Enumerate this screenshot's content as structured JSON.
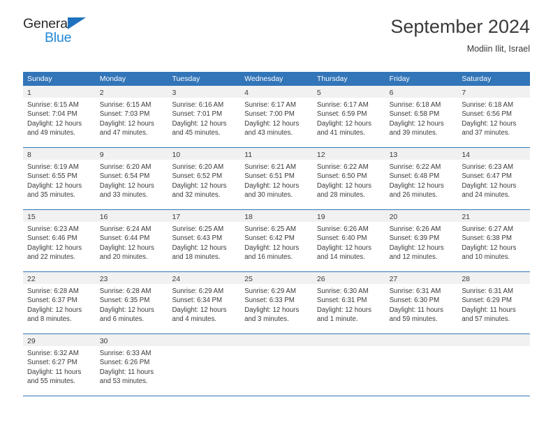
{
  "brand": {
    "name_top": "General",
    "name_bottom": "Blue",
    "triangle_color": "#1f72bd",
    "text_color_bottom": "#1f86d8"
  },
  "header": {
    "title": "September 2024",
    "subtitle": "Modiin Ilit, Israel"
  },
  "theme": {
    "header_blue": "#3275b8",
    "day_band_gray": "#f1f1f1",
    "text": "#3a3a3a"
  },
  "weekdays": [
    "Sunday",
    "Monday",
    "Tuesday",
    "Wednesday",
    "Thursday",
    "Friday",
    "Saturday"
  ],
  "weeks": [
    [
      {
        "day": "1",
        "sunrise": "Sunrise: 6:15 AM",
        "sunset": "Sunset: 7:04 PM",
        "daylight": "Daylight: 12 hours and 49 minutes."
      },
      {
        "day": "2",
        "sunrise": "Sunrise: 6:15 AM",
        "sunset": "Sunset: 7:03 PM",
        "daylight": "Daylight: 12 hours and 47 minutes."
      },
      {
        "day": "3",
        "sunrise": "Sunrise: 6:16 AM",
        "sunset": "Sunset: 7:01 PM",
        "daylight": "Daylight: 12 hours and 45 minutes."
      },
      {
        "day": "4",
        "sunrise": "Sunrise: 6:17 AM",
        "sunset": "Sunset: 7:00 PM",
        "daylight": "Daylight: 12 hours and 43 minutes."
      },
      {
        "day": "5",
        "sunrise": "Sunrise: 6:17 AM",
        "sunset": "Sunset: 6:59 PM",
        "daylight": "Daylight: 12 hours and 41 minutes."
      },
      {
        "day": "6",
        "sunrise": "Sunrise: 6:18 AM",
        "sunset": "Sunset: 6:58 PM",
        "daylight": "Daylight: 12 hours and 39 minutes."
      },
      {
        "day": "7",
        "sunrise": "Sunrise: 6:18 AM",
        "sunset": "Sunset: 6:56 PM",
        "daylight": "Daylight: 12 hours and 37 minutes."
      }
    ],
    [
      {
        "day": "8",
        "sunrise": "Sunrise: 6:19 AM",
        "sunset": "Sunset: 6:55 PM",
        "daylight": "Daylight: 12 hours and 35 minutes."
      },
      {
        "day": "9",
        "sunrise": "Sunrise: 6:20 AM",
        "sunset": "Sunset: 6:54 PM",
        "daylight": "Daylight: 12 hours and 33 minutes."
      },
      {
        "day": "10",
        "sunrise": "Sunrise: 6:20 AM",
        "sunset": "Sunset: 6:52 PM",
        "daylight": "Daylight: 12 hours and 32 minutes."
      },
      {
        "day": "11",
        "sunrise": "Sunrise: 6:21 AM",
        "sunset": "Sunset: 6:51 PM",
        "daylight": "Daylight: 12 hours and 30 minutes."
      },
      {
        "day": "12",
        "sunrise": "Sunrise: 6:22 AM",
        "sunset": "Sunset: 6:50 PM",
        "daylight": "Daylight: 12 hours and 28 minutes."
      },
      {
        "day": "13",
        "sunrise": "Sunrise: 6:22 AM",
        "sunset": "Sunset: 6:48 PM",
        "daylight": "Daylight: 12 hours and 26 minutes."
      },
      {
        "day": "14",
        "sunrise": "Sunrise: 6:23 AM",
        "sunset": "Sunset: 6:47 PM",
        "daylight": "Daylight: 12 hours and 24 minutes."
      }
    ],
    [
      {
        "day": "15",
        "sunrise": "Sunrise: 6:23 AM",
        "sunset": "Sunset: 6:46 PM",
        "daylight": "Daylight: 12 hours and 22 minutes."
      },
      {
        "day": "16",
        "sunrise": "Sunrise: 6:24 AM",
        "sunset": "Sunset: 6:44 PM",
        "daylight": "Daylight: 12 hours and 20 minutes."
      },
      {
        "day": "17",
        "sunrise": "Sunrise: 6:25 AM",
        "sunset": "Sunset: 6:43 PM",
        "daylight": "Daylight: 12 hours and 18 minutes."
      },
      {
        "day": "18",
        "sunrise": "Sunrise: 6:25 AM",
        "sunset": "Sunset: 6:42 PM",
        "daylight": "Daylight: 12 hours and 16 minutes."
      },
      {
        "day": "19",
        "sunrise": "Sunrise: 6:26 AM",
        "sunset": "Sunset: 6:40 PM",
        "daylight": "Daylight: 12 hours and 14 minutes."
      },
      {
        "day": "20",
        "sunrise": "Sunrise: 6:26 AM",
        "sunset": "Sunset: 6:39 PM",
        "daylight": "Daylight: 12 hours and 12 minutes."
      },
      {
        "day": "21",
        "sunrise": "Sunrise: 6:27 AM",
        "sunset": "Sunset: 6:38 PM",
        "daylight": "Daylight: 12 hours and 10 minutes."
      }
    ],
    [
      {
        "day": "22",
        "sunrise": "Sunrise: 6:28 AM",
        "sunset": "Sunset: 6:37 PM",
        "daylight": "Daylight: 12 hours and 8 minutes."
      },
      {
        "day": "23",
        "sunrise": "Sunrise: 6:28 AM",
        "sunset": "Sunset: 6:35 PM",
        "daylight": "Daylight: 12 hours and 6 minutes."
      },
      {
        "day": "24",
        "sunrise": "Sunrise: 6:29 AM",
        "sunset": "Sunset: 6:34 PM",
        "daylight": "Daylight: 12 hours and 4 minutes."
      },
      {
        "day": "25",
        "sunrise": "Sunrise: 6:29 AM",
        "sunset": "Sunset: 6:33 PM",
        "daylight": "Daylight: 12 hours and 3 minutes."
      },
      {
        "day": "26",
        "sunrise": "Sunrise: 6:30 AM",
        "sunset": "Sunset: 6:31 PM",
        "daylight": "Daylight: 12 hours and 1 minute."
      },
      {
        "day": "27",
        "sunrise": "Sunrise: 6:31 AM",
        "sunset": "Sunset: 6:30 PM",
        "daylight": "Daylight: 11 hours and 59 minutes."
      },
      {
        "day": "28",
        "sunrise": "Sunrise: 6:31 AM",
        "sunset": "Sunset: 6:29 PM",
        "daylight": "Daylight: 11 hours and 57 minutes."
      }
    ],
    [
      {
        "day": "29",
        "sunrise": "Sunrise: 6:32 AM",
        "sunset": "Sunset: 6:27 PM",
        "daylight": "Daylight: 11 hours and 55 minutes."
      },
      {
        "day": "30",
        "sunrise": "Sunrise: 6:33 AM",
        "sunset": "Sunset: 6:26 PM",
        "daylight": "Daylight: 11 hours and 53 minutes."
      },
      {
        "day": "",
        "sunrise": "",
        "sunset": "",
        "daylight": ""
      },
      {
        "day": "",
        "sunrise": "",
        "sunset": "",
        "daylight": ""
      },
      {
        "day": "",
        "sunrise": "",
        "sunset": "",
        "daylight": ""
      },
      {
        "day": "",
        "sunrise": "",
        "sunset": "",
        "daylight": ""
      },
      {
        "day": "",
        "sunrise": "",
        "sunset": "",
        "daylight": ""
      }
    ]
  ]
}
